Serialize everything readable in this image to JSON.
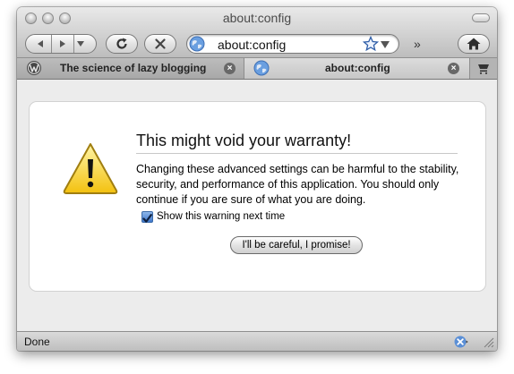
{
  "window": {
    "title": "about:config"
  },
  "toolbar": {
    "url": "about:config",
    "overflow": "»"
  },
  "tabs": [
    {
      "label": "The science of lazy blogging",
      "icon": "wordpress-icon",
      "active": false
    },
    {
      "label": "about:config",
      "icon": "globe-icon",
      "active": true
    }
  ],
  "warning": {
    "heading": "This might void your warranty!",
    "body": "Changing these advanced settings can be harmful to the stability, security, and performance of this application. You should only continue if you are sure of what you are doing.",
    "checkbox_label": "Show this warning next time",
    "checkbox_checked": true,
    "button_label": "I'll be careful, I promise!"
  },
  "status": {
    "text": "Done"
  },
  "colors": {
    "warning_yellow": "#f7d21f",
    "checkbox_blue": "#3f78cc"
  }
}
